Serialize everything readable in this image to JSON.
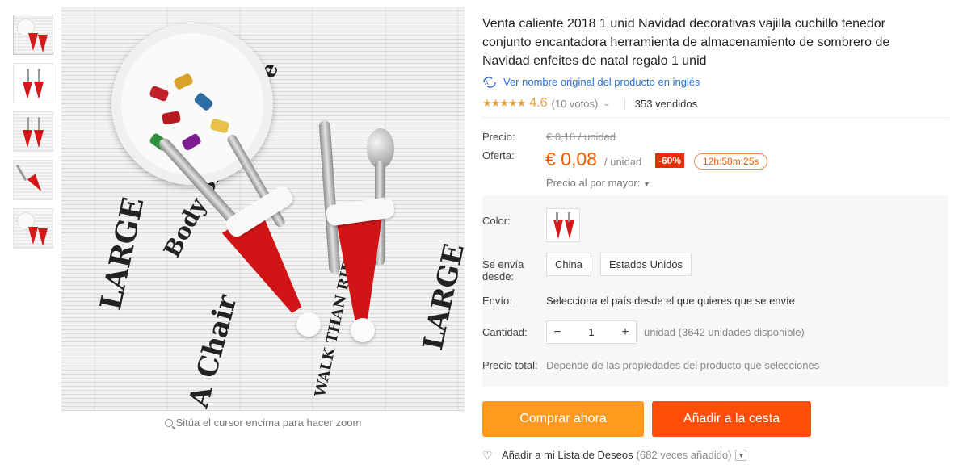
{
  "gallery": {
    "thumbnail_count": 5,
    "zoom_hint": "Sitúa el cursor encima para hacer zoom"
  },
  "product": {
    "title": "Venta caliente 2018 1 unid Navidad decorativas vajilla cuchillo tenedor conjunto encantadora herramienta de almacenamiento de sombrero de Navidad enfeites de natal regalo 1 unid",
    "original_link": "Ver nombre original del producto en inglés",
    "rating": 4.6,
    "rating_text": "4.6",
    "votes": "(10 votos)",
    "sold": "353 vendidos"
  },
  "price": {
    "price_label": "Precio:",
    "old_price": "€ 0,18 / unidad",
    "offer_label": "Oferta:",
    "offer_price": "€ 0,08",
    "offer_unit": "/ unidad",
    "discount": "-60%",
    "timer": "12h:58m:25s",
    "wholesale": "Precio al por mayor:"
  },
  "attributes": {
    "color_label": "Color:",
    "ships_from_label": "Se envía desde:",
    "ships_from_options": [
      "China",
      "Estados Unidos"
    ],
    "shipping_label": "Envío:",
    "shipping_message": "Selecciona el país desde el que quieres que se envíe",
    "quantity_label": "Cantidad:",
    "quantity_value": "1",
    "quantity_info": "unidad (3642 unidades disponible)",
    "total_label": "Precio total:",
    "total_message": "Depende de las propiedades del producto que selecciones"
  },
  "actions": {
    "buy_now": "Comprar ahora",
    "add_to_cart": "Añadir a la cesta",
    "wishlist": "Añadir a mi Lista de Deseos",
    "wishlist_count": "(682 veces añadido)"
  },
  "colors": {
    "accent_orange": "#ff9a1f",
    "cart_orange": "#ff4e0a",
    "price_color": "#f25a00",
    "link_blue": "#2a6ed8"
  }
}
